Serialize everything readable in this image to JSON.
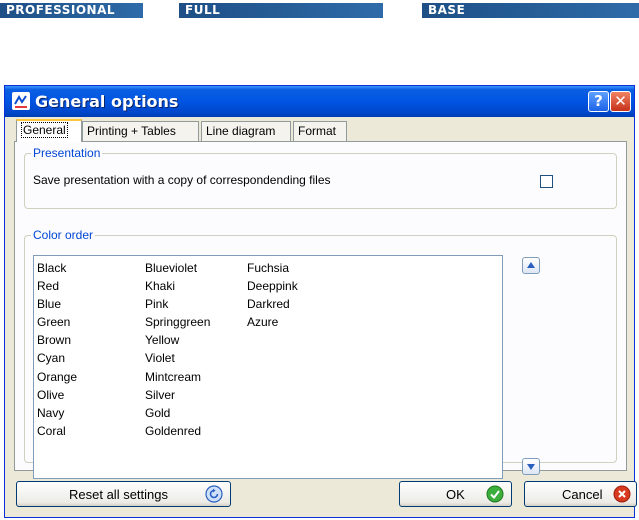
{
  "editions": {
    "professional": "PROFESSIONAL",
    "full": "FULL",
    "base": "BASE"
  },
  "window": {
    "title": "General options",
    "help_label": "?",
    "close_label": "✕"
  },
  "tabs": [
    {
      "label": "General",
      "active": true
    },
    {
      "label": "Printing + Tables",
      "active": false
    },
    {
      "label": "Line diagram",
      "active": false
    },
    {
      "label": "Format",
      "active": false
    }
  ],
  "presentation": {
    "group_title": "Presentation",
    "option_label": "Save presentation with a copy of correspondending files",
    "checked": false
  },
  "color_order": {
    "group_title": "Color order",
    "columns": [
      [
        "Black",
        "Red",
        "Blue",
        "Green",
        "Brown",
        "Cyan",
        "Orange",
        "Olive",
        "Navy",
        "Coral"
      ],
      [
        "Blueviolet",
        "Khaki",
        "Pink",
        "Springgreen",
        "Yellow",
        "Violet",
        "Mintcream",
        "Silver",
        "Gold",
        "Goldenred"
      ],
      [
        "Fuchsia",
        "Deeppink",
        "Darkred",
        "Azure"
      ]
    ],
    "move_up_icon": "arrow-up-icon",
    "move_down_icon": "arrow-down-icon"
  },
  "buttons": {
    "reset": {
      "label": "Reset all settings",
      "icon": "reset-icon"
    },
    "ok": {
      "label": "OK",
      "icon": "check-icon"
    },
    "cancel": {
      "label": "Cancel",
      "icon": "cancel-icon"
    }
  },
  "colors": {
    "titlebar": "#0054e3",
    "banner": "#2e6ba8",
    "group_title": "#0046d5",
    "ok_icon": "#3cae3c",
    "cancel_icon": "#d83a1f"
  }
}
